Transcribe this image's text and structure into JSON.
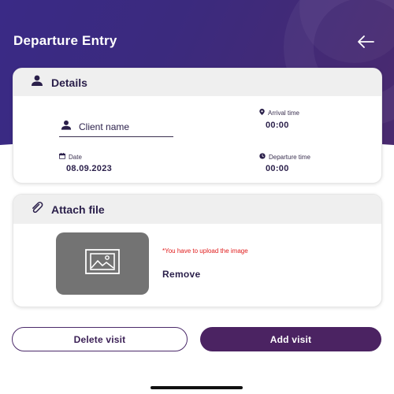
{
  "header": {
    "title": "Departure Entry",
    "back_icon": "arrow-left-icon"
  },
  "details": {
    "heading": "Details",
    "heading_icon": "person-icon",
    "client_placeholder": "Client name",
    "arrival_label": "Arrival time",
    "arrival_value": "00:00",
    "date_label": "Date",
    "date_value": "08.09.2023",
    "departure_label": "Departure time",
    "departure_value": "00:00"
  },
  "attach": {
    "heading": "Attach file",
    "heading_icon": "paperclip-icon",
    "warning": "*You have to upload the image",
    "remove_label": "Remove"
  },
  "actions": {
    "delete_label": "Delete visit",
    "add_label": "Add visit"
  },
  "colors": {
    "primary": "#3a2a86",
    "accent": "#4b2362",
    "warning": "#e01b1b",
    "placeholder_bg": "#737373"
  }
}
